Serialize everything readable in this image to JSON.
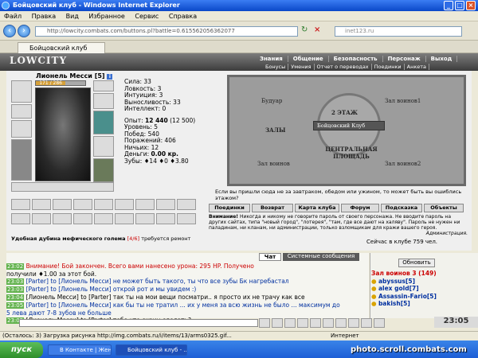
{
  "window": {
    "title": "Бойцовский клуб - Windows Internet Explorer"
  },
  "menu": {
    "items": [
      "Файл",
      "Правка",
      "Вид",
      "Избранное",
      "Сервис",
      "Справка"
    ]
  },
  "address": {
    "url": "http://lowcity.combats.com/buttons.pl?battle=0.615562056362077",
    "search_placeholder": "inet123.ru"
  },
  "tab": {
    "label": "Бойцовский клуб"
  },
  "game": {
    "logo": "LOWCITY",
    "nav_top": [
      "Знания",
      "Общение",
      "Безопасность",
      "Персонаж",
      "Выход"
    ],
    "nav_bottom": [
      "Бонусы",
      "Умения",
      "Отчет о переводах",
      "Поединки",
      "Анкета"
    ]
  },
  "character": {
    "name": "Лионель Месси",
    "level_tag": "[5]",
    "hp_text": "171 / 286",
    "hp_fraction": 0.6,
    "stats": [
      "Сила: 33",
      "Ловкость: 3",
      "Интуиция: 3",
      "Выносливость: 33",
      "Интеллект: 0"
    ],
    "exp_label": "Опыт:",
    "exp_value": "12 440",
    "exp_next": "(12 500)",
    "details": [
      "Уровень: 5",
      "Побед: 540",
      "Поражений: 406",
      "Ничьих: 12"
    ],
    "money_label": "Деньги:",
    "money_value": "0.00 кр.",
    "teeth": "Зубы: ♦14 ♦0 ♦3.80",
    "repair_note": "Удобная дубина мефического голема",
    "repair_count": "[4/6]",
    "repair_suffix": "требуется ремонт"
  },
  "map": {
    "labels": [
      "Будуар",
      "Зал воинов1",
      "2 ЭТАЖ",
      "Бойцовский Клуб",
      "ЗАЛЫ",
      "ЦЕНТРАЛЬНАЯ ПЛОЩАДЬ",
      "Зал воинов",
      "Зал воинов2"
    ]
  },
  "quote": "Если вы пришли сюда не за завтраком, обедом или ужином, то может быть вы ошиблись этажом?",
  "buttons": [
    "Поединки",
    "Возврат",
    "Карта клуба",
    "Форум",
    "Подсказка",
    "Объекты"
  ],
  "warning": {
    "title": "Внимание!",
    "text": "Никогда и никому не говорите пароль от своего персонажа. Не вводите пароль на других сайтах, типа \"новый город\", \"лотерея\", \"там, где все дают на халяву\". Пароль не нужен ни паладинам, ни кланам, ни администрации, только взломщикам для кражи вашего героя.",
    "sign": "Администрация."
  },
  "online": "Сейчас в клубе 759 чел.",
  "chat": {
    "tabs": [
      "Чат",
      "Системные сообщения"
    ],
    "lines": [
      {
        "time": "23:02",
        "text": "Внимание! Бой закончен. Всего вами нанесено урона: 295 HP. Получено"
      },
      {
        "time": "",
        "text": "получили ♦1.00 за этот бой."
      },
      {
        "time": "23:03",
        "text": "[Parter] to [Лионель Месси] не может быть такого, ты что все зубы Бк нагребастал"
      },
      {
        "time": "23:03",
        "text": "[Parter] to [Лионель Месси] открой рот и мы увидем :)"
      },
      {
        "time": "23:04",
        "text": "[Лионель Месси] to [Parter] так ты на мои вещи посматри.. я просто их не трачу как все"
      },
      {
        "time": "23:05",
        "text": "[Parter] to [Лионель Месси] как бы ты не тратил ... их у меня за всю жизнь не было ... максимум до"
      },
      {
        "time": "",
        "text": "5 лева дают 7-8 зубов не больше"
      },
      {
        "time": "23:05",
        "text": "[Лионель Месси] to [Parter] тебе что скрин сделать?"
      }
    ]
  },
  "room": {
    "refresh_label": "Обновить",
    "title": "Зал воинов 3 (149)",
    "users": [
      "abyssus[5]",
      "alex gold[7]",
      "Assassin-Fario[5]",
      "bakish[5]"
    ]
  },
  "clock": "23:05",
  "statusbar": "(Осталось: 3) Загрузка рисунка http://img.combats.ru/i/items/13/arms0325.gif...",
  "statusbar_zone": "Интернет",
  "taskbar": {
    "start_label": "пуск",
    "items": [
      "В Контакте | Женя ...",
      "Бойцовский клуб - ..."
    ],
    "watermark": "photo.scroll.combats.com"
  },
  "colors": {
    "titlebar": "#0a48c8",
    "chat_time": "#62b24d",
    "taskbar": "#1d5ed6",
    "start": "#2e8e2b"
  }
}
